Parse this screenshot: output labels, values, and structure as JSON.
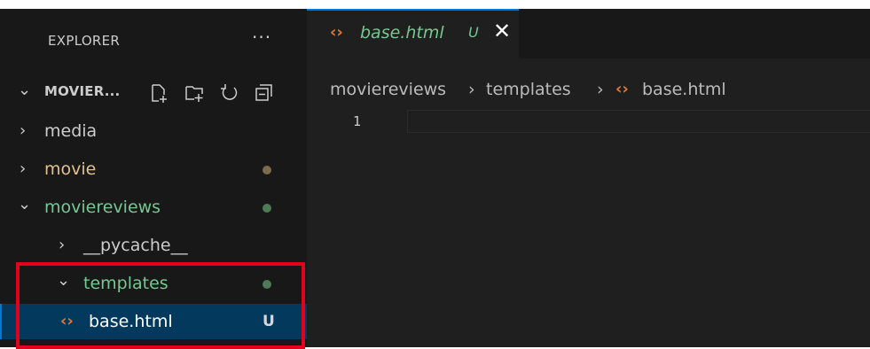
{
  "explorer": {
    "title": "EXPLORER",
    "more_label": "···",
    "folder_name": "MOVIER...",
    "actions": [
      "new-file-icon",
      "new-folder-icon",
      "refresh-icon",
      "collapse-all-icon"
    ]
  },
  "tree": [
    {
      "label": "media",
      "expanded": false
    },
    {
      "label": "movie",
      "expanded": false
    },
    {
      "label": "moviereviews",
      "expanded": true
    },
    {
      "label": "__pycache__",
      "expanded": false
    },
    {
      "label": "templates",
      "expanded": true
    },
    {
      "label": "base.html",
      "status": "U",
      "icon": "html-file-icon"
    }
  ],
  "tab": {
    "name": "base.html",
    "status": "U",
    "close_glyph": "✕"
  },
  "breadcrumb": {
    "items": [
      "moviereviews",
      "templates",
      "base.html"
    ],
    "separator": "›"
  },
  "editor": {
    "line_numbers": [
      "1"
    ]
  },
  "colors": {
    "sidebar_bg": "#181818",
    "editor_bg": "#1f1f1f",
    "untracked_green": "#73c991",
    "modified_dot": "#7d6b4f",
    "untracked_dot": "#4e7a58",
    "html_icon": "#e37933",
    "selection_bg": "#04395e",
    "accent_blue": "#0078d4",
    "highlight_red": "#e3001b"
  }
}
